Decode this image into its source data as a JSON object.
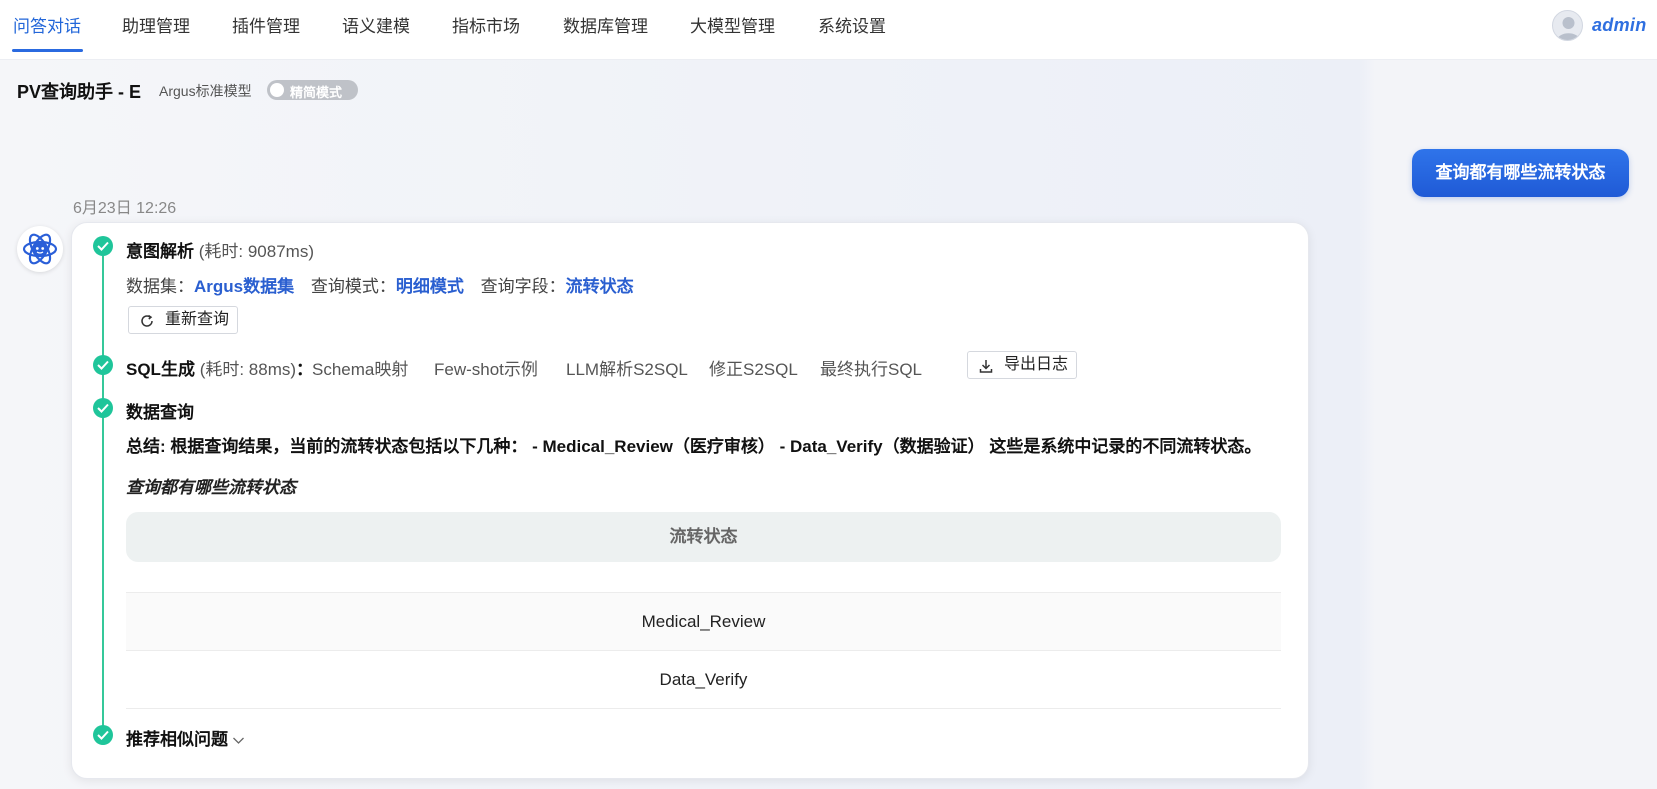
{
  "nav": {
    "items": [
      {
        "label": "问答对话",
        "active": true
      },
      {
        "label": "助理管理",
        "active": false
      },
      {
        "label": "插件管理",
        "active": false
      },
      {
        "label": "语义建模",
        "active": false
      },
      {
        "label": "指标市场",
        "active": false
      },
      {
        "label": "数据库管理",
        "active": false
      },
      {
        "label": "大模型管理",
        "active": false
      },
      {
        "label": "系统设置",
        "active": false
      }
    ],
    "user": "admin",
    "accent_color": "#2266d9"
  },
  "header": {
    "assistant_title": "PV查询助手 - E",
    "model_name": "Argus标准模型",
    "mode_label": "精简模式"
  },
  "conversation": {
    "user_message": "查询都有哪些流转状态",
    "timestamp": "6月23日 12:26",
    "steps": {
      "intent": {
        "title": "意图解析",
        "time": "(耗时: 9087ms)",
        "dataset_label": "数据集：",
        "dataset_value": "Argus数据集",
        "mode_label": "查询模式：",
        "mode_value": "明细模式",
        "field_label": "查询字段：",
        "field_value": "流转状态",
        "requery_button": "重新查询"
      },
      "sql": {
        "title": "SQL生成",
        "time": "(耗时: 88ms)",
        "colon": "：",
        "tabs": [
          "Schema映射",
          "Few-shot示例",
          "LLM解析S2SQL",
          "修正S2SQL",
          "最终执行SQL"
        ],
        "export_button": "导出日志"
      },
      "data_query": {
        "title": "数据查询",
        "summary": "总结: 根据查询结果，当前的流转状态包括以下几种：  - Medical_Review（医疗审核） - Data_Verify（数据验证） 这些是系统中记录的不同流转状态。",
        "query_text": "查询都有哪些流转状态",
        "table": {
          "header": "流转状态",
          "rows": [
            "Medical_Review",
            "Data_Verify"
          ]
        }
      },
      "recommend": {
        "title": "推荐相似问题"
      }
    },
    "step_color": "#1fc59a",
    "user_bubble_color": "#2a6ae0"
  }
}
